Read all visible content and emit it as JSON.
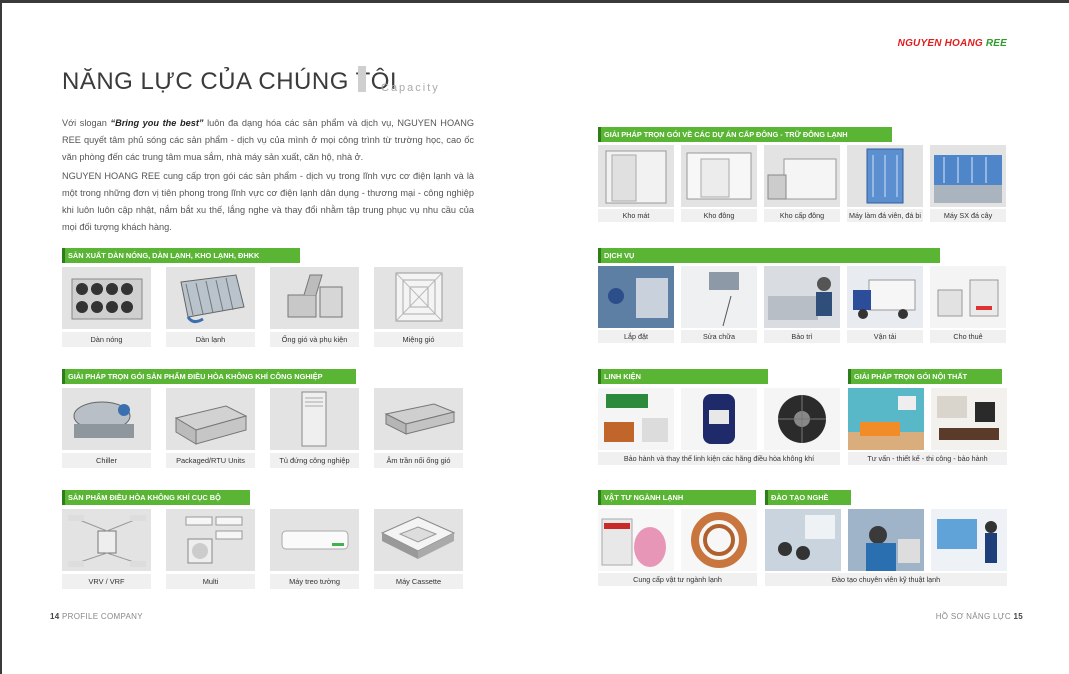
{
  "brand": {
    "main": "NGUYEN HOANG ",
    "ree": "REE"
  },
  "header": {
    "title": "NĂNG LỰC CỦA CHÚNG TÔI",
    "subtitle": "Capacity"
  },
  "intro": {
    "p1_pre": "Với slogan ",
    "slogan": "“Bring you the best”",
    "p1_post": " luôn đa dạng hóa các sản phẩm và dịch vụ, NGUYEN HOANG REE quyết tâm phủ sóng các sản phẩm - dịch vụ của mình ở mọi công trình từ trường học, cao ốc văn phòng đến các trung tâm mua sắm, nhà máy sản xuất, căn hộ, nhà ở.",
    "p2": "NGUYEN HOANG REE cung cấp trọn gói các sản phẩm - dịch vụ trong lĩnh vực cơ điện lạnh và là một trong những đơn vị tiên phong trong lĩnh vực cơ điện lạnh dân dụng - thương mại - công nghiệp khi luôn luôn cập nhật, nắm bắt xu thế, lắng nghe và thay đổi nhằm tập trung phục vụ nhu cầu của mọi đối tượng khách hàng."
  },
  "left_sections": [
    {
      "title": "SẢN XUẤT DÀN NÓNG, DÀN LẠNH, KHO LẠNH, ĐHKK",
      "items": [
        "Dàn nóng",
        "Dàn lạnh",
        "Ống gió và phụ kiện",
        "Miệng gió"
      ]
    },
    {
      "title": "GIẢI PHÁP TRỌN GÓI SẢN PHẨM ĐIỀU HÒA KHÔNG KHÍ CÔNG NGHIỆP",
      "items": [
        "Chiller",
        "Packaged/RTU Units",
        "Tủ đứng công nghiệp",
        "Âm trần nối ống gió"
      ]
    },
    {
      "title": "SẢN PHẨM ĐIỀU HÒA KHÔNG KHÍ CỤC BỘ",
      "items": [
        "VRV / VRF",
        "Multi",
        "Máy treo tường",
        "Máy Cassette"
      ]
    }
  ],
  "right_sections": {
    "cold": {
      "title": "GIẢI PHÁP TRỌN GÓI VỀ CÁC DỰ ÁN CẤP ĐÔNG - TRỮ ĐÔNG LẠNH",
      "items": [
        "Kho mát",
        "Kho đông",
        "Kho cấp đông",
        "Máy làm đá viên, đá bi",
        "Máy SX đá cây"
      ]
    },
    "service": {
      "title": "DỊCH VỤ",
      "items": [
        "Lắp đặt",
        "Sửa chữa",
        "Bảo trì",
        "Vận tải",
        "Cho thuê"
      ]
    },
    "parts": {
      "title": "LINH KIỆN",
      "caption": "Bảo hành và thay thế linh kiện các hãng điều hòa không khí"
    },
    "interior": {
      "title": "GIẢI PHÁP TRỌN GÓI NỘI THẤT",
      "caption": "Tư vấn - thiết kế - thi công - bảo hành"
    },
    "supplies": {
      "title": "VẬT TƯ NGÀNH LẠNH",
      "caption": "Cung cấp vật tư ngành lạnh"
    },
    "training": {
      "title": "ĐÀO TẠO NGHỀ",
      "caption": "Đào tạo chuyên viên kỹ thuật lạnh"
    }
  },
  "footer": {
    "left_num": "14",
    "left_text": " PROFILE COMPANY",
    "right_text": "HỒ SƠ NĂNG LỰC ",
    "right_num": "15"
  },
  "colors": {
    "accent": "#5ab535",
    "brand_red": "#e11d1d"
  }
}
